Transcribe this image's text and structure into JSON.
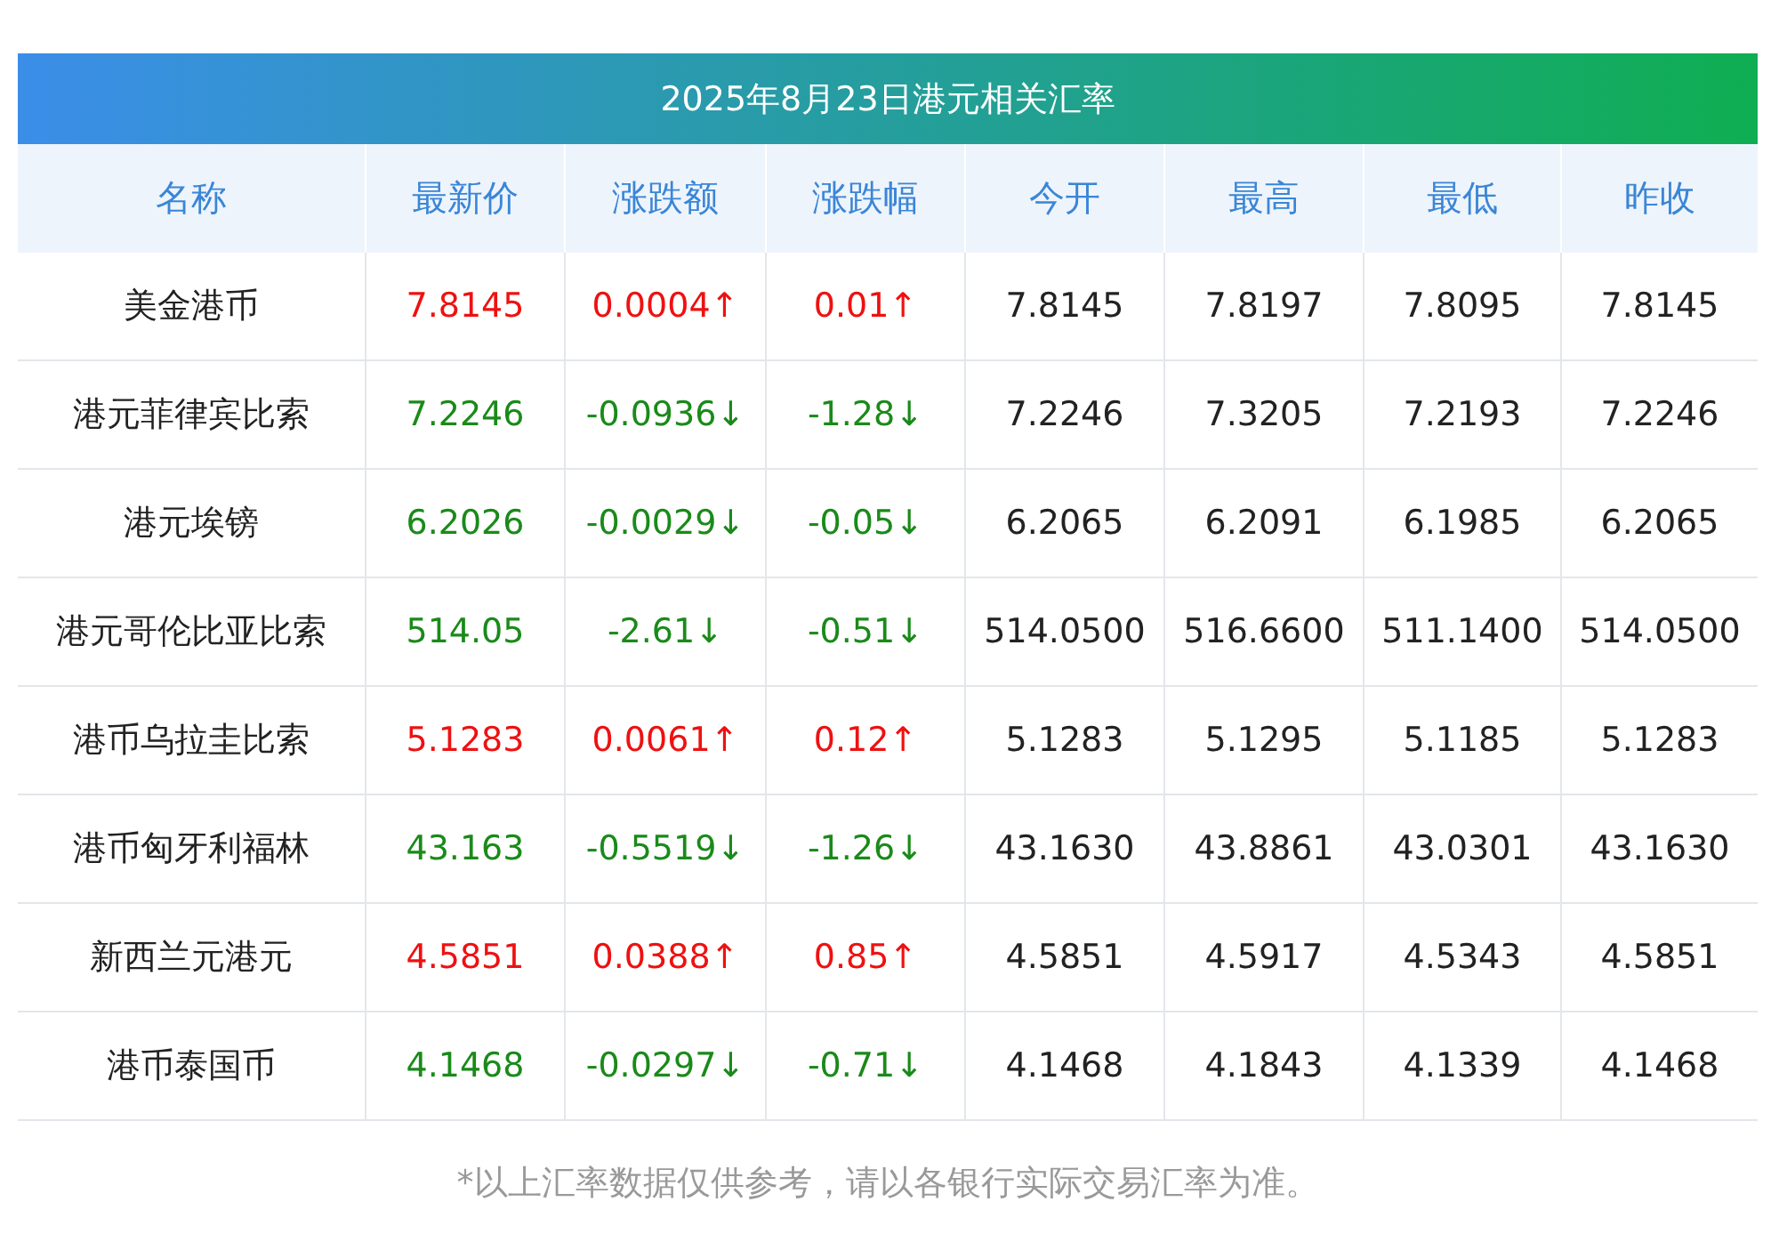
{
  "title": "2025年8月23日港元相关汇率",
  "columns": [
    "名称",
    "最新价",
    "涨跌额",
    "涨跌幅",
    "今开",
    "最高",
    "最低",
    "昨收"
  ],
  "rows": [
    {
      "kind": "up",
      "cells": [
        "美金港币",
        "7.8145",
        "0.0004↑",
        "0.01↑",
        "7.8145",
        "7.8197",
        "7.8095",
        "7.8145"
      ]
    },
    {
      "kind": "down",
      "cells": [
        "港元菲律宾比索",
        "7.2246",
        "-0.0936↓",
        "-1.28↓",
        "7.2246",
        "7.3205",
        "7.2193",
        "7.2246"
      ]
    },
    {
      "kind": "down",
      "cells": [
        "港元埃镑",
        "6.2026",
        "-0.0029↓",
        "-0.05↓",
        "6.2065",
        "6.2091",
        "6.1985",
        "6.2065"
      ]
    },
    {
      "kind": "down",
      "cells": [
        "港元哥伦比亚比索",
        "514.05",
        "-2.61↓",
        "-0.51↓",
        "514.0500",
        "516.6600",
        "511.1400",
        "514.0500"
      ]
    },
    {
      "kind": "up",
      "cells": [
        "港币乌拉圭比索",
        "5.1283",
        "0.0061↑",
        "0.12↑",
        "5.1283",
        "5.1295",
        "5.1185",
        "5.1283"
      ]
    },
    {
      "kind": "down",
      "cells": [
        "港币匈牙利福林",
        "43.163",
        "-0.5519↓",
        "-1.26↓",
        "43.1630",
        "43.8861",
        "43.0301",
        "43.1630"
      ]
    },
    {
      "kind": "up",
      "cells": [
        "新西兰元港元",
        "4.5851",
        "0.0388↑",
        "0.85↑",
        "4.5851",
        "4.5917",
        "4.5343",
        "4.5851"
      ]
    },
    {
      "kind": "down",
      "cells": [
        "港币泰国币",
        "4.1468",
        "-0.0297↓",
        "-0.71↓",
        "4.1468",
        "4.1843",
        "4.1339",
        "4.1468"
      ]
    }
  ],
  "footnote": "*以上汇率数据仅供参考，请以各银行实际交易汇率为准。"
}
